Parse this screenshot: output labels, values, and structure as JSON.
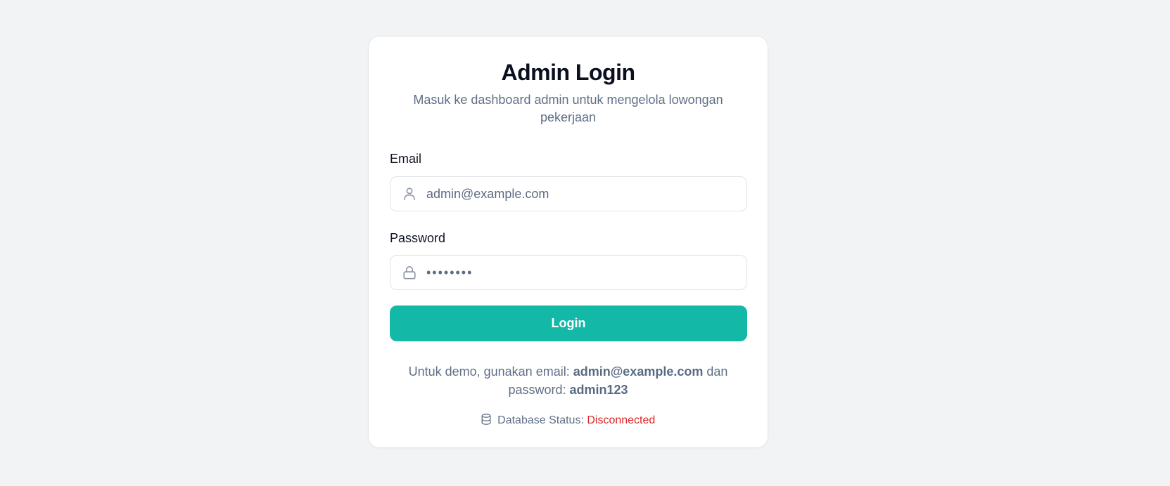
{
  "login_card": {
    "title": "Admin Login",
    "subtitle": "Masuk ke dashboard admin untuk mengelola lowongan pekerjaan"
  },
  "form": {
    "email": {
      "label": "Email",
      "value": "admin@example.com",
      "icon": "user-icon"
    },
    "password": {
      "label": "Password",
      "value": "••••••••",
      "icon": "lock-icon"
    },
    "submit_label": "Login"
  },
  "demo_hint": {
    "prefix": "Untuk demo, gunakan email:",
    "email": "admin@example.com",
    "middle": "dan password:",
    "password": "admin123"
  },
  "db_status": {
    "label": "Database Status:",
    "value": "Disconnected",
    "icon": "database-icon",
    "value_color": "#dc2626"
  },
  "colors": {
    "accent": "#14b8a6",
    "page_background": "#f2f3f5",
    "error": "#dc2626"
  }
}
